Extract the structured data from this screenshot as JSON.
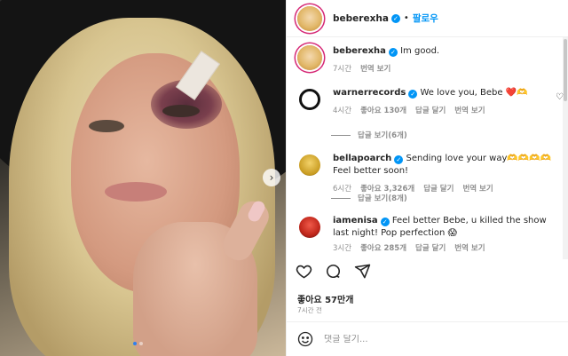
{
  "post": {
    "username": "beberexha",
    "follow_label": "팔로우",
    "separator": "•",
    "caption": "Im good.",
    "caption_time": "7시간",
    "translate_label": "번역 보기"
  },
  "comments": [
    {
      "username": "warnerrecords",
      "text": "We love you, Bebe ❤️🫶",
      "time": "4시간",
      "likes": "좋아요 130개",
      "reply": "답글 달기",
      "translate": "번역 보기",
      "replies": "답글 보기(6개)"
    },
    {
      "username": "bellapoarch",
      "text": "Sending love your way🫶🫶🫶🫶 Feel better soon!",
      "time": "6시간",
      "likes": "좋아요 3,326개",
      "reply": "답글 달기",
      "translate": "번역 보기",
      "replies": "답글 보기(8개)"
    },
    {
      "username": "iamenisa",
      "text": "Feel better Bebe, u killed the show last night! Pop perfection 😱",
      "time": "3시간",
      "likes": "좋아요 285개",
      "reply": "답글 달기",
      "translate": "번역 보기"
    }
  ],
  "engagement": {
    "likes": "좋아요 57만개",
    "time": "7시간 전"
  },
  "composer": {
    "placeholder": "댓글 달기..."
  },
  "carousel": {
    "next": "›",
    "slide_count": 2,
    "active_index": 0
  },
  "colors": {
    "accent": "#0095f6",
    "text": "#262626",
    "secondary": "#8e8e8e",
    "heart": "#ed4956"
  }
}
